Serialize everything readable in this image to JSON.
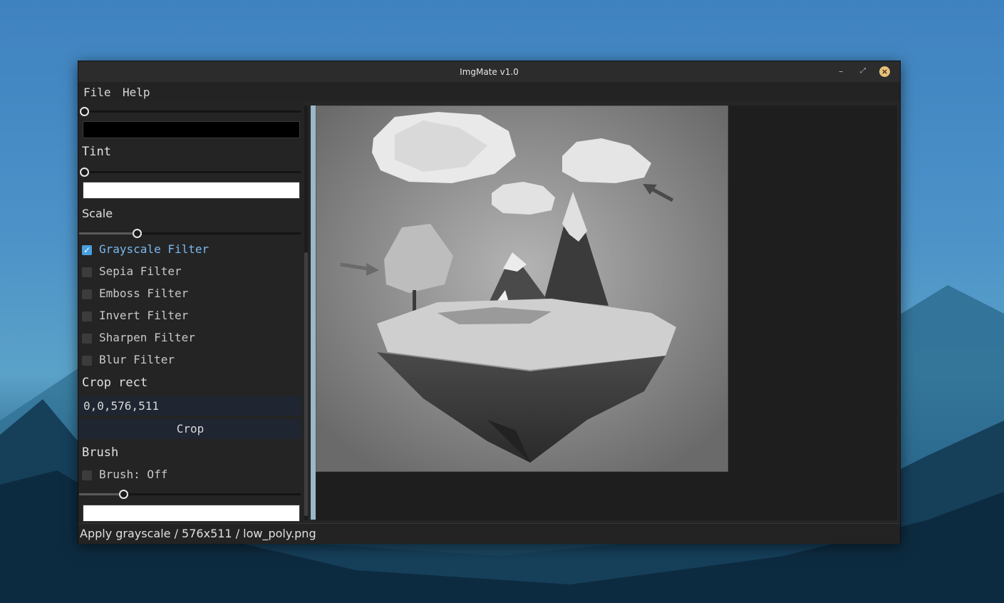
{
  "window": {
    "title": "ImgMate v1.0"
  },
  "menu": {
    "items": [
      "File",
      "Help"
    ]
  },
  "sidebar": {
    "brightness": {
      "value": 0.0
    },
    "tint": {
      "label": "Tint",
      "value": 0.0
    },
    "scale": {
      "label": "Scale",
      "value": 0.26
    },
    "filters": [
      {
        "label": "Grayscale Filter",
        "checked": true
      },
      {
        "label": "Sepia Filter",
        "checked": false
      },
      {
        "label": "Emboss Filter",
        "checked": false
      },
      {
        "label": "Invert Filter",
        "checked": false
      },
      {
        "label": "Sharpen Filter",
        "checked": false
      },
      {
        "label": "Blur Filter",
        "checked": false
      }
    ],
    "crop": {
      "label": "Crop rect",
      "value": "0,0,576,511",
      "button_label": "Crop"
    },
    "brush": {
      "label": "Brush",
      "toggle_label": "Brush: Off",
      "checked": false,
      "size": 0.2
    }
  },
  "colors": {
    "swatch1": "#000000",
    "swatch2": "#ffffff",
    "swatch3": "#ffffff",
    "accent": "#4a9fe0"
  },
  "status": {
    "text": "Apply grayscale / 576x511 / low_poly.png"
  }
}
